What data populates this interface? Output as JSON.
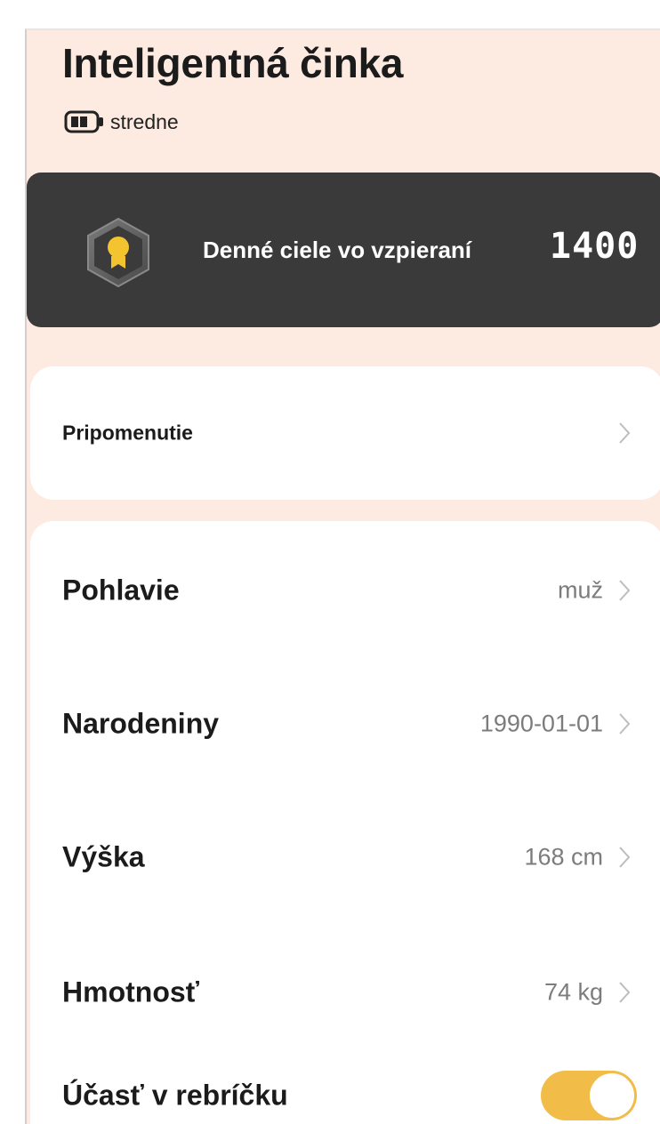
{
  "header": {
    "title": "Inteligentná činka",
    "battery_icon": "battery-medium-icon",
    "battery_status": "stredne"
  },
  "daily_goal": {
    "icon": "medal-badge-icon",
    "label": "Denné ciele vo vzpieraní",
    "value": "1400"
  },
  "reminder": {
    "label": "Pripomenutie",
    "icon": "chevron-right-icon"
  },
  "profile": {
    "gender": {
      "label": "Pohlavie",
      "value": "muž"
    },
    "birthday": {
      "label": "Narodeniny",
      "value": "1990-01-01"
    },
    "height": {
      "label": "Výška",
      "value": "168 cm"
    },
    "weight": {
      "label": "Hmotnosť",
      "value": "74 kg"
    },
    "leaderboard": {
      "label": "Účasť v rebríčku",
      "enabled": true
    }
  },
  "colors": {
    "page_background": "#fdebe2",
    "banner_background": "#3a3a3a",
    "toggle_on": "#f2bc48",
    "medal_gold": "#f4c430"
  }
}
